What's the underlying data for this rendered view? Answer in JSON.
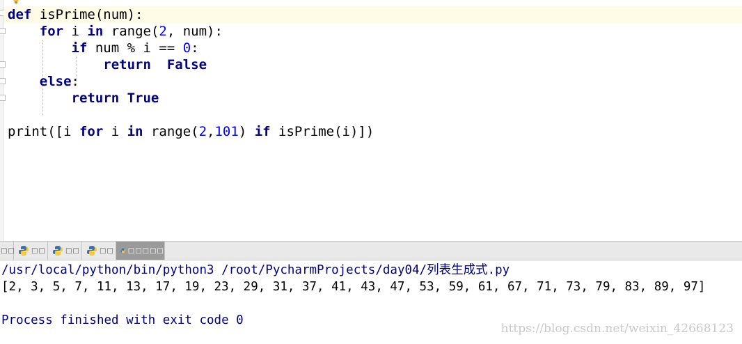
{
  "editor": {
    "lines": [
      {
        "parts": [
          {
            "t": "def",
            "k": "kw"
          },
          {
            "t": " isPrime(num):",
            "k": ""
          }
        ]
      },
      {
        "parts": [
          {
            "t": "    ",
            "k": ""
          },
          {
            "t": "for",
            "k": "kw"
          },
          {
            "t": " i ",
            "k": ""
          },
          {
            "t": "in",
            "k": "kw"
          },
          {
            "t": " range(",
            "k": ""
          },
          {
            "t": "2",
            "k": "num"
          },
          {
            "t": ", num):",
            "k": ""
          }
        ]
      },
      {
        "parts": [
          {
            "t": "        ",
            "k": ""
          },
          {
            "t": "if",
            "k": "kw"
          },
          {
            "t": " num % i == ",
            "k": ""
          },
          {
            "t": "0",
            "k": "num"
          },
          {
            "t": ":",
            "k": ""
          }
        ]
      },
      {
        "parts": [
          {
            "t": "            ",
            "k": ""
          },
          {
            "t": "return",
            "k": "kw"
          },
          {
            "t": "  ",
            "k": ""
          },
          {
            "t": "False",
            "k": "kw"
          }
        ]
      },
      {
        "parts": [
          {
            "t": "    ",
            "k": ""
          },
          {
            "t": "else",
            "k": "kw"
          },
          {
            "t": ":",
            "k": ""
          }
        ]
      },
      {
        "parts": [
          {
            "t": "        ",
            "k": ""
          },
          {
            "t": "return",
            "k": "kw"
          },
          {
            "t": " ",
            "k": ""
          },
          {
            "t": "True",
            "k": "kw"
          }
        ]
      },
      {
        "parts": []
      },
      {
        "parts": [
          {
            "t": "print([i ",
            "k": ""
          },
          {
            "t": "for",
            "k": "kw"
          },
          {
            "t": " i ",
            "k": ""
          },
          {
            "t": "in",
            "k": "kw"
          },
          {
            "t": " range(",
            "k": ""
          },
          {
            "t": "2",
            "k": "num"
          },
          {
            "t": ",",
            "k": ""
          },
          {
            "t": "101",
            "k": "num"
          },
          {
            "t": ") ",
            "k": ""
          },
          {
            "t": "if",
            "k": "kw"
          },
          {
            "t": " isPrime(i)])",
            "k": ""
          }
        ]
      }
    ]
  },
  "tabs": [
    {
      "label": "□□",
      "icon": "none",
      "active": false
    },
    {
      "label": "□□",
      "icon": "python-icon",
      "active": false
    },
    {
      "label": "□□",
      "icon": "python-icon",
      "active": false
    },
    {
      "label": "□□",
      "icon": "python-icon",
      "active": false
    },
    {
      "label": "□□□□□",
      "icon": "python-icon",
      "active": true
    }
  ],
  "console": {
    "command": "/usr/local/python/bin/python3 /root/PycharmProjects/day04/列表生成式.py",
    "output": "[2, 3, 5, 7, 11, 13, 17, 19, 23, 29, 31, 37, 41, 43, 47, 53, 59, 61, 67, 71, 73, 79, 83, 89, 97]",
    "exit_message": "Process finished with exit code 0"
  },
  "watermark": "https://blog.csdn.net/weixin_42668123",
  "colors": {
    "keyword": "#000080",
    "number": "#0000ff",
    "console_text": "#000080",
    "current_line": "#fefce6",
    "active_tab": "#9a9a9a"
  }
}
